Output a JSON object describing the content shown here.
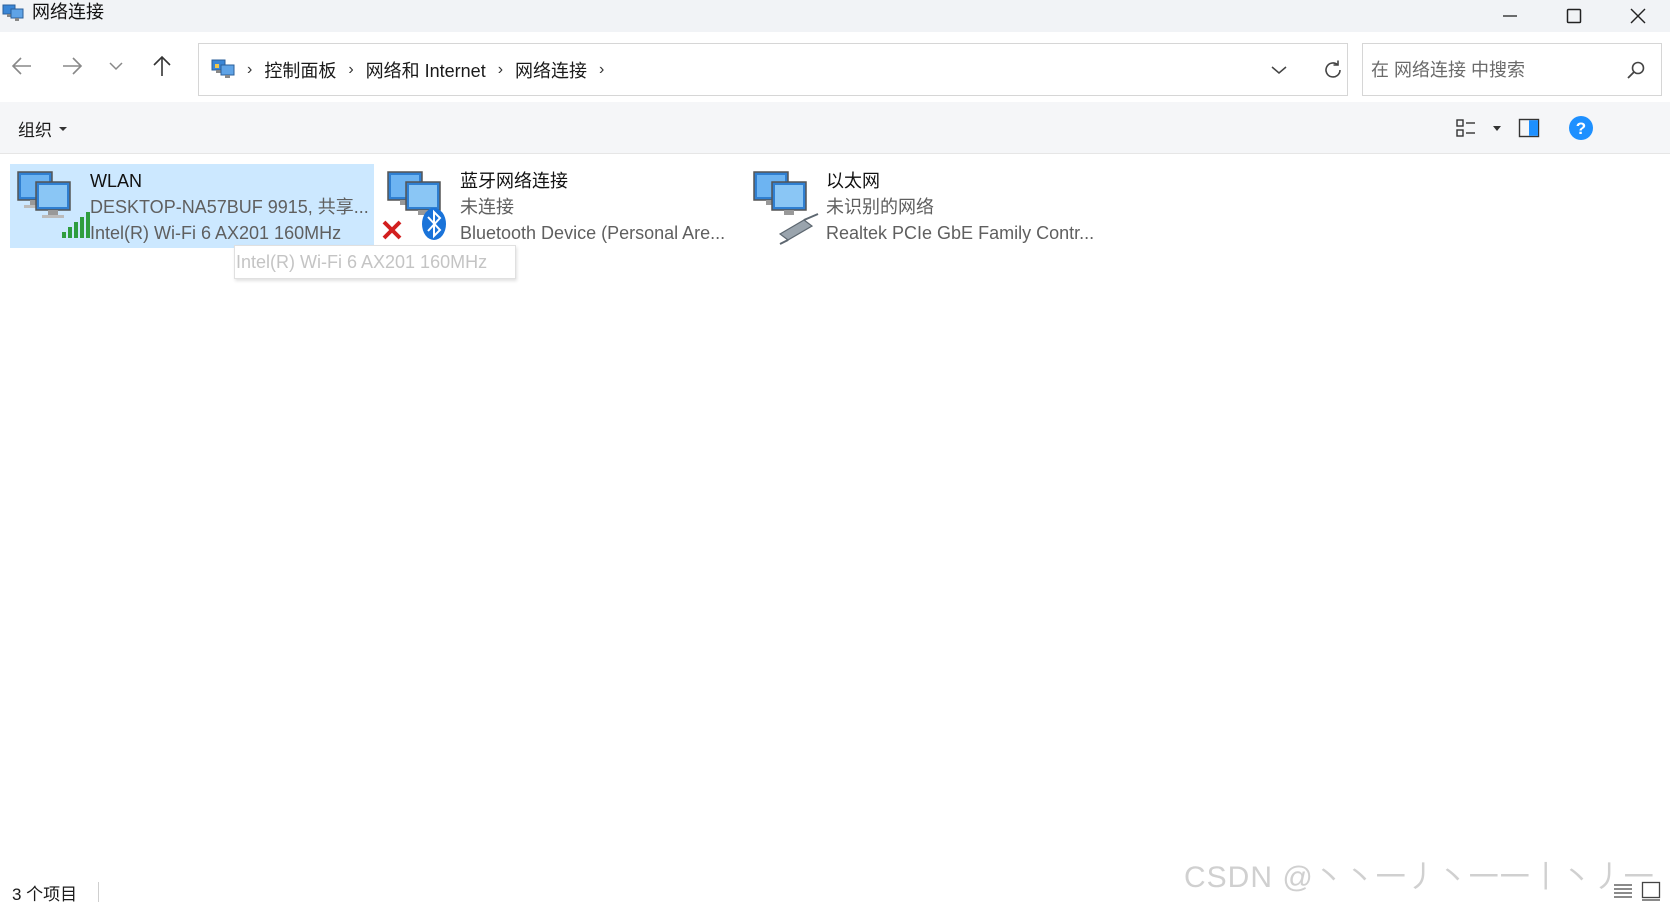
{
  "window": {
    "title": "网络连接",
    "minimize_label": "minimize",
    "maximize_label": "maximize",
    "close_label": "close"
  },
  "address": {
    "breadcrumbs": [
      "控制面板",
      "网络和 Internet",
      "网络连接"
    ]
  },
  "search": {
    "placeholder": "在 网络连接 中搜索"
  },
  "toolbar": {
    "organize_label": "组织"
  },
  "connections": [
    {
      "name": "WLAN",
      "line1": "DESKTOP-NA57BUF 9915, 共享...",
      "line2": "Intel(R) Wi-Fi 6 AX201 160MHz",
      "icon": "wifi-adapter-icon",
      "selected": true
    },
    {
      "name": "蓝牙网络连接",
      "line1": "未连接",
      "line2": "Bluetooth Device (Personal Are...",
      "icon": "bluetooth-adapter-icon",
      "selected": false
    },
    {
      "name": "以太网",
      "line1": "未识别的网络",
      "line2": "Realtek PCIe GbE Family Contr...",
      "icon": "ethernet-adapter-icon",
      "selected": false
    }
  ],
  "tooltip": {
    "text": "Intel(R) Wi-Fi 6 AX201 160MHz"
  },
  "status": {
    "item_count": "3 个项目"
  },
  "watermark": {
    "text": "CSDN @丶丶一丿丶一一丨丶丿一"
  },
  "colors": {
    "selection": "#cce8ff",
    "accent": "#0078d4",
    "help": "#1e90ff"
  }
}
